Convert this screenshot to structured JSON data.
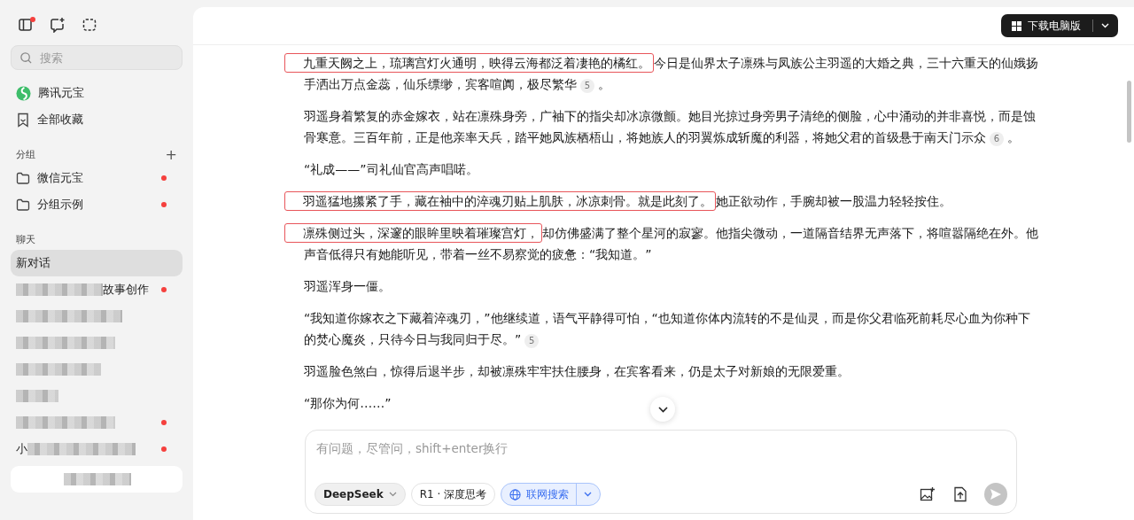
{
  "sidebar": {
    "new_dot": true,
    "search": {
      "placeholder": "搜索"
    },
    "nav": [
      {
        "label": "腾讯元宝",
        "kind": "app"
      },
      {
        "label": "全部收藏",
        "kind": "bookmark"
      }
    ],
    "groups": {
      "title": "分组",
      "add_label": "+",
      "items": [
        {
          "label": "微信元宝",
          "unread": true
        },
        {
          "label": "分组示例",
          "unread": true
        }
      ]
    },
    "chats": {
      "title": "聊天",
      "items": [
        {
          "kind": "plain",
          "label": "新对话",
          "selected": true,
          "unread": false
        },
        {
          "kind": "blur_before",
          "label": "故事创作",
          "selected": false,
          "unread": true
        },
        {
          "kind": "blurred",
          "selected": false,
          "unread": false
        },
        {
          "kind": "blurred",
          "selected": false,
          "unread": false
        },
        {
          "kind": "blurred",
          "selected": false,
          "unread": false
        },
        {
          "kind": "blurred",
          "selected": false,
          "unread": false
        },
        {
          "kind": "blurred",
          "selected": false,
          "unread": true
        },
        {
          "kind": "blur_after",
          "label": "小",
          "selected": false,
          "unread": true
        },
        {
          "kind": "blurred_card",
          "selected": false,
          "unread": false
        }
      ]
    }
  },
  "header": {
    "download_button": "下载电脑版"
  },
  "article": [
    [
      {
        "kind": "highlight",
        "text": "九重天阙之上，琉璃宫灯火通明，映得云海都泛着凄艳的橘红。"
      },
      {
        "kind": "text",
        "text": "今日是仙界太子凛殊与凤族公主羽遥的大婚之典，三十六重天的仙娥扬手洒出万点金蕊，仙乐缥缈，宾客喧阗，极尽繁华"
      },
      {
        "kind": "cite",
        "text": "5"
      },
      {
        "kind": "text",
        "text": "。"
      }
    ],
    [
      {
        "kind": "text",
        "text": "羽遥身着繁复的赤金嫁衣，站在凛殊身旁，广袖下的指尖却冰凉微颤。她目光掠过身旁男子清绝的侧脸，心中涌动的并非喜悦，而是蚀骨寒意。三百年前，正是他亲率天兵，踏平她凤族栖梧山，将她族人的羽翼炼成斩魔的利器，将她父君的首级悬于南天门示众"
      },
      {
        "kind": "cite",
        "text": "6"
      },
      {
        "kind": "text",
        "text": "。"
      }
    ],
    [
      {
        "kind": "text",
        "text": "“礼成——”司礼仙官高声唱喏。"
      }
    ],
    [
      {
        "kind": "highlight",
        "text": "羽遥猛地攥紧了手，藏在袖中的淬魂刃贴上肌肤，冰凉刺骨。就是此刻了。"
      },
      {
        "kind": "text",
        "text": "她正欲动作，手腕却被一股温力轻轻按住。"
      }
    ],
    [
      {
        "kind": "highlight",
        "text": "凛殊侧过头，深邃的眼眸里映着璀璨宫灯，"
      },
      {
        "kind": "text",
        "text": "却仿佛盛满了整个星河的寂寥。他指尖微动，一道隔音结界无声落下，将喧嚣隔绝在外。他声音低得只有她能听见，带着一丝不易察觉的疲惫：“我知道。”"
      }
    ],
    [
      {
        "kind": "text",
        "text": "羽遥浑身一僵。"
      }
    ],
    [
      {
        "kind": "text",
        "text": "“我知道你嫁衣之下藏着淬魂刃，”他继续道，语气平静得可怕，“也知道你体内流转的不是仙灵，而是你父君临死前耗尽心血为你种下的焚心魔炎，只待今日与我同归于尽。”"
      },
      {
        "kind": "cite",
        "text": "5"
      }
    ],
    [
      {
        "kind": "text",
        "text": "羽遥脸色煞白，惊得后退半步，却被凛殊牢牢扶住腰身，在宾客看来，仍是太子对新娘的无限爱重。"
      }
    ],
    [
      {
        "kind": "text",
        "text": "“那你为何……”"
      }
    ]
  ],
  "composer": {
    "placeholder": "有问题，尽管问，shift+enter换行",
    "model": "DeepSeek",
    "toggles": [
      {
        "label": "R1 · 深度思考",
        "selected": false,
        "has_menu": false
      },
      {
        "label": "联网搜索",
        "selected": true,
        "has_menu": true
      }
    ]
  }
}
